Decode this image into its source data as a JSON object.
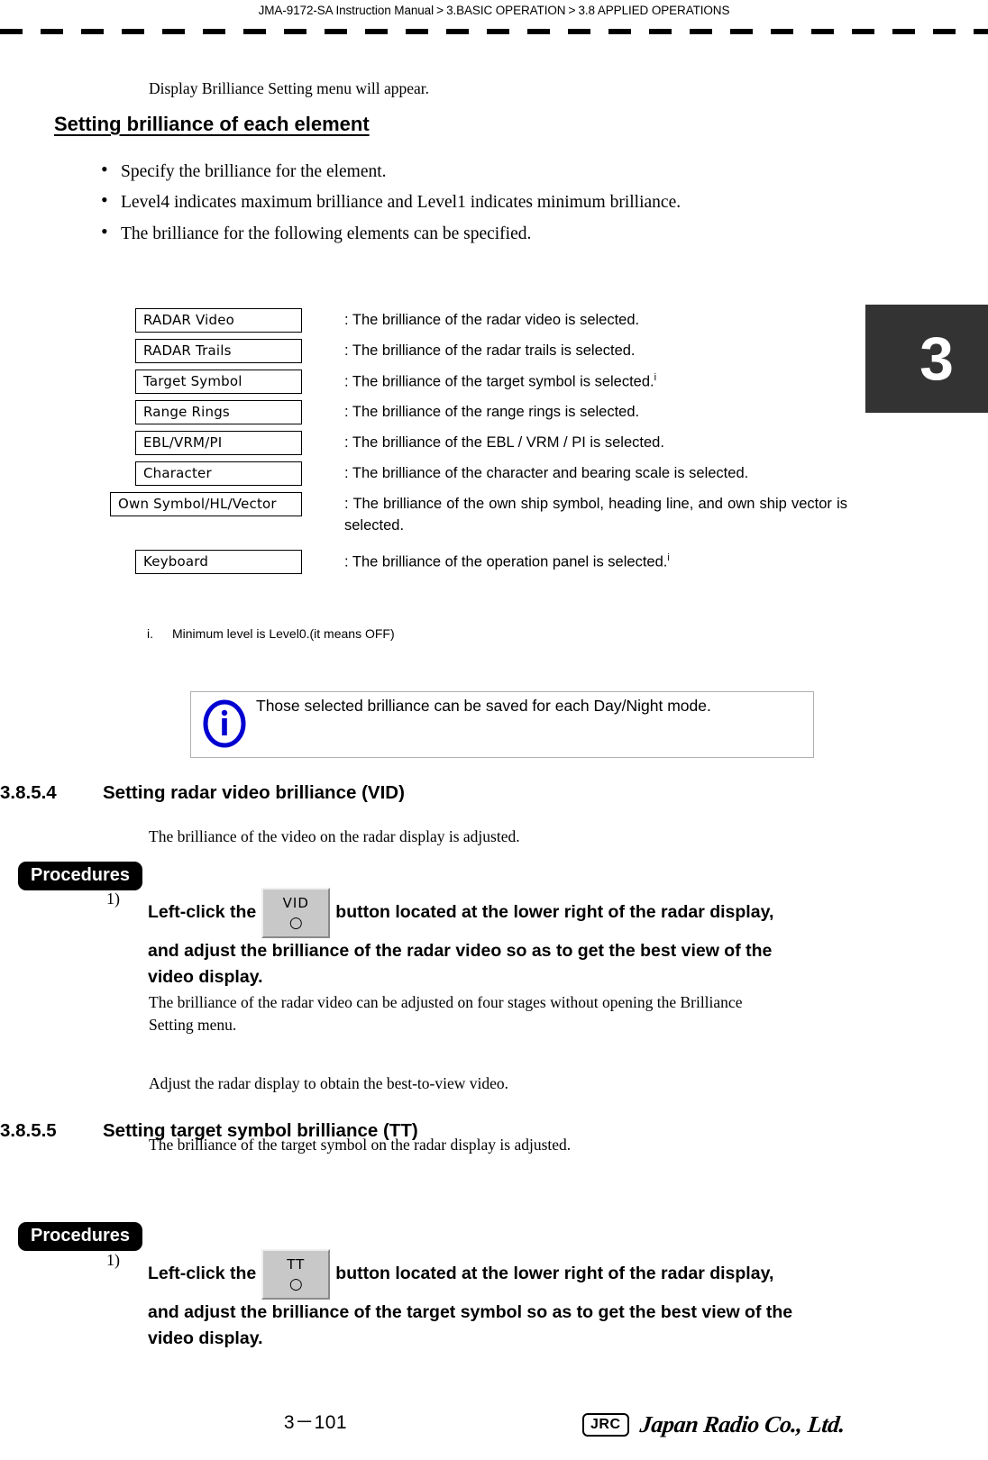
{
  "header": {
    "manual": "JMA-9172-SA Instruction Manual",
    "sep1": ">",
    "chapter": "3.BASIC OPERATION",
    "sep2": ">",
    "section": "3.8  APPLIED OPERATIONS"
  },
  "chapter_tab": {
    "number": "3"
  },
  "intro_line": "Display Brilliance Setting menu will appear.",
  "sub_heading": "Setting brilliance of each element",
  "bullets": [
    "Specify the brilliance for the element.",
    "Level4  indicates maximum brilliance and  Level1  indicates minimum brilliance.",
    "The brilliance for the following elements can be specified."
  ],
  "elements": [
    {
      "label": "RADAR Video",
      "desc": ": The brilliance of the radar video is selected.",
      "note": ""
    },
    {
      "label": "RADAR Trails",
      "desc": ": The brilliance of the radar trails is selected.",
      "note": ""
    },
    {
      "label": "Target Symbol",
      "desc": ": The brilliance of the target symbol is selected.",
      "note": "i"
    },
    {
      "label": "Range Rings",
      "desc": ": The brilliance of the range rings is selected.",
      "note": ""
    },
    {
      "label": "EBL/VRM/PI",
      "desc": ": The brilliance of the EBL / VRM / PI is selected.",
      "note": ""
    },
    {
      "label": "Character",
      "desc": ": The brilliance of the character and bearing scale is selected.",
      "note": ""
    },
    {
      "label": "Own Symbol/HL/Vector",
      "desc": ": The brilliance of the own ship symbol, heading line, and own ship vector is selected.",
      "note": ""
    },
    {
      "label": "Keyboard",
      "desc": ": The brilliance of the operation panel is selected.",
      "note": "i"
    }
  ],
  "footnote": {
    "marker": "i.",
    "text": "Minimum level is Level0.(it means OFF)"
  },
  "info_box": {
    "icon": "info-icon",
    "icon_letter": "i",
    "text": "Those selected brilliance can be saved for each Day/Night mode.",
    "border_color": "#b0b0b0",
    "icon_color": "#0000d0"
  },
  "section_vid": {
    "number": "3.8.5.4",
    "title": "Setting radar video brilliance (VID)",
    "intro": "The brilliance of the video on the radar display is adjusted.",
    "procedures_label": "Procedures",
    "step_number": "1)",
    "step_part1": "Left-click the",
    "step_part2": "button located at the lower right of the radar display, and adjust the brilliance of the radar video so as to get the best view of the video display.",
    "button": {
      "label": "VID",
      "glyph": "○"
    },
    "note1": "The brilliance of the radar video can be adjusted on four stages without opening the Brilliance Setting menu.",
    "note2": "Adjust the radar display to obtain the best-to-view video."
  },
  "section_tt": {
    "number": "3.8.5.5",
    "title": "Setting target symbol brilliance (TT)",
    "intro": "The brilliance of the target symbol on the radar display is adjusted.",
    "procedures_label": "Procedures",
    "step_number": "1)",
    "step_part1": "Left-click the",
    "step_part2": "button located at the lower right of the radar display, and adjust the brilliance of the target symbol so as to get the best view of the video display.",
    "button": {
      "label": "TT",
      "glyph": "○"
    }
  },
  "footer": {
    "page": "3－101",
    "logo_mark": "JRC",
    "logo_name": "Japan Radio Co., Ltd."
  }
}
